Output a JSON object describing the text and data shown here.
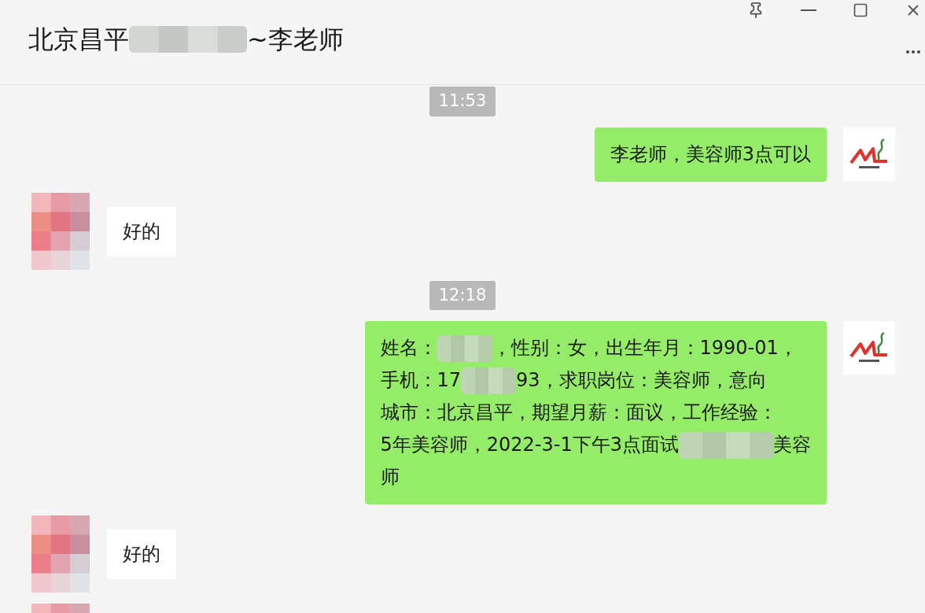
{
  "window": {
    "title_parts": [
      {
        "kind": "text",
        "text": "北京昌平"
      },
      {
        "kind": "redacted"
      },
      {
        "kind": "text",
        "text": "~李老师"
      }
    ]
  },
  "messages": [
    {
      "kind": "time",
      "text": "11:53"
    },
    {
      "kind": "sent",
      "lines": [
        [
          {
            "kind": "text",
            "text": "李老师，美容师3点可以"
          }
        ]
      ]
    },
    {
      "kind": "received",
      "lines": [
        [
          {
            "kind": "text",
            "text": "好的"
          }
        ]
      ]
    },
    {
      "kind": "time",
      "text": "12:18"
    },
    {
      "kind": "sent",
      "lines": [
        [
          {
            "kind": "text",
            "text": "姓名："
          },
          {
            "kind": "redacted"
          },
          {
            "kind": "text",
            "text": "，性别：女，出生年月：1990-01，"
          }
        ],
        [
          {
            "kind": "text",
            "text": "手机：17"
          },
          {
            "kind": "redacted"
          },
          {
            "kind": "text",
            "text": "93，求职岗位：美容师，意向"
          }
        ],
        [
          {
            "kind": "text",
            "text": "城市：北京昌平，期望月薪：面议，工作经验："
          }
        ],
        [
          {
            "kind": "text",
            "text": "5年美容师，2022-3-1下午3点面试"
          },
          {
            "kind": "redacted"
          },
          {
            "kind": "text",
            "text": "美容"
          }
        ],
        [
          {
            "kind": "text",
            "text": "师"
          }
        ]
      ]
    },
    {
      "kind": "received",
      "lines": [
        [
          {
            "kind": "text",
            "text": "好的"
          }
        ]
      ]
    },
    {
      "kind": "received"
    }
  ]
}
